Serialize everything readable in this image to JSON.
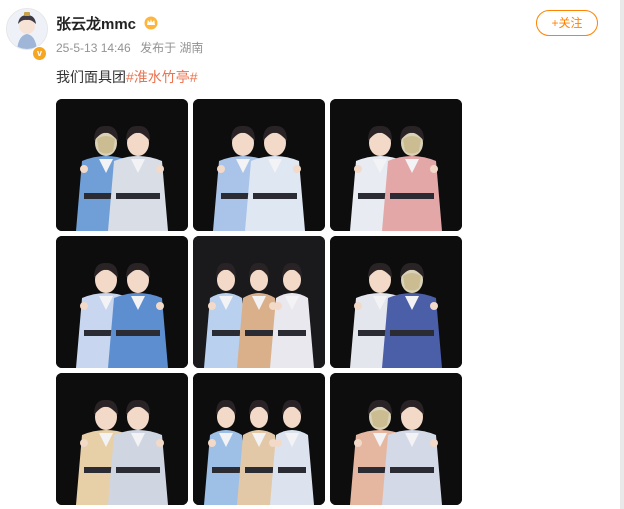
{
  "post": {
    "username": "张云龙mmc",
    "timestamp": "25-5-13 14:46",
    "published_from": "发布于 湖南",
    "text_plain": "我们面具团",
    "hashtag": "#淮水竹亭#",
    "follow_label": "+关注"
  },
  "colors": {
    "accent": "#ff8200",
    "hashtag": "#eb7350",
    "meta": "#939393",
    "verified_badge": "#f5a623"
  },
  "icons": [
    "avatar",
    "verified-icon",
    "crown-icon"
  ],
  "photos": [
    {
      "people": [
        {
          "robe": "#6f9fd6",
          "mask": true
        },
        {
          "robe": "#d8dde6",
          "mask": false
        }
      ]
    },
    {
      "people": [
        {
          "robe": "#a9c4e8",
          "mask": false
        },
        {
          "robe": "#dfe7f3",
          "mask": false
        }
      ]
    },
    {
      "people": [
        {
          "robe": "#e8ecf2",
          "mask": false
        },
        {
          "robe": "#e3a7a7",
          "mask": true
        }
      ]
    },
    {
      "people": [
        {
          "robe": "#c8d6ef",
          "mask": false
        },
        {
          "robe": "#5d8fd0",
          "mask": false
        }
      ]
    },
    {
      "people": [
        {
          "robe": "#b9d0ef",
          "mask": false
        },
        {
          "robe": "#d9b08a",
          "mask": false
        },
        {
          "robe": "#e8e8ee",
          "mask": false
        }
      ]
    },
    {
      "people": [
        {
          "robe": "#e3e6ec",
          "mask": false
        },
        {
          "robe": "#4b5ea8",
          "mask": true
        }
      ]
    },
    {
      "people": [
        {
          "robe": "#e7cfa8",
          "mask": false
        },
        {
          "robe": "#cfd6e2",
          "mask": false
        }
      ]
    },
    {
      "people": [
        {
          "robe": "#9ec0e6",
          "mask": false
        },
        {
          "robe": "#e2c8a6",
          "mask": false
        },
        {
          "robe": "#dce3ef",
          "mask": false
        }
      ]
    },
    {
      "people": [
        {
          "robe": "#e6b7a0",
          "mask": true
        },
        {
          "robe": "#d3d9e6",
          "mask": false
        }
      ]
    }
  ]
}
